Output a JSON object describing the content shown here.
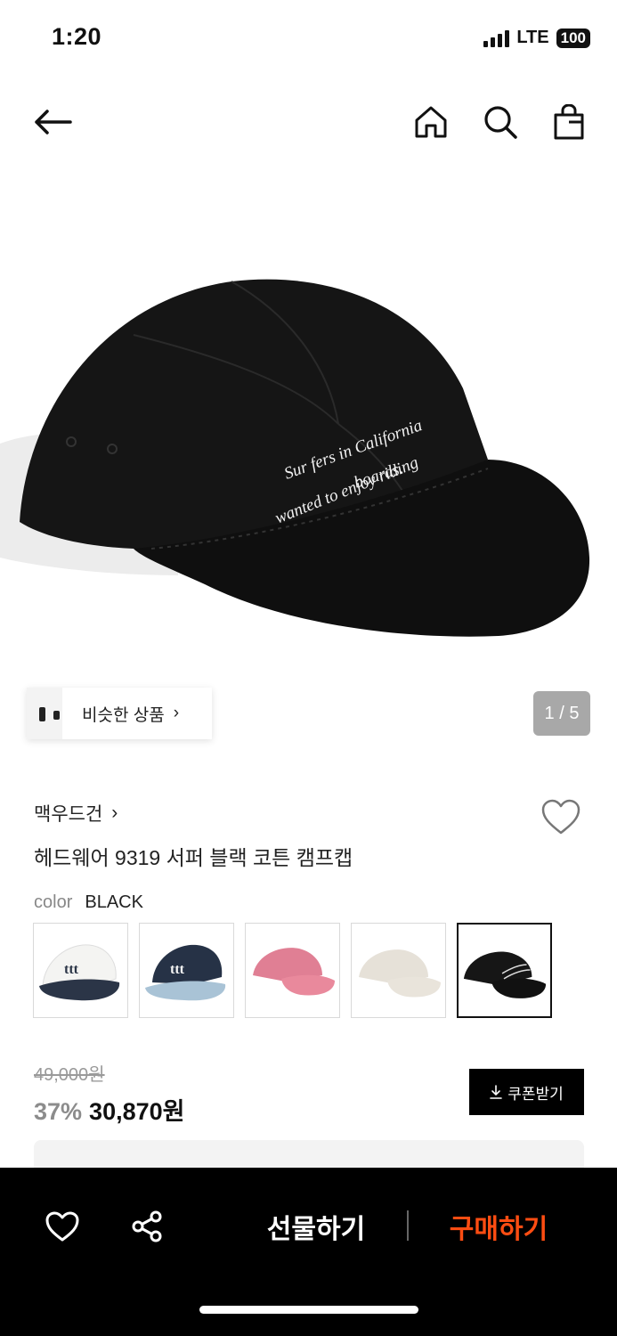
{
  "status_bar": {
    "time": "1:20",
    "network": "LTE",
    "battery": "100"
  },
  "nav": {
    "back_icon": "arrow-left-icon",
    "home_icon": "home-icon",
    "search_icon": "search-icon",
    "bag_icon": "shopping-bag-icon"
  },
  "hero": {
    "embroidery_lines": [
      "Sur fers in California",
      "wanted to enjoy riding",
      "boards."
    ],
    "similar_label": "비슷한 상품",
    "page_counter": "1 / 5"
  },
  "product": {
    "brand": "맥우드건",
    "name": "헤드웨어 9319 서퍼 블랙 코튼 캠프캡",
    "color_label": "color",
    "color_value": "BLACK",
    "swatches": [
      {
        "name": "white-navy",
        "crown": "#f4f4f2",
        "bill": "#2b3547"
      },
      {
        "name": "navy-lightblue",
        "crown": "#263246",
        "bill": "#a9c3d6"
      },
      {
        "name": "pink",
        "crown": "#e07f94",
        "bill": "#e9899c"
      },
      {
        "name": "ivory",
        "crown": "#e6e1d8",
        "bill": "#e9e4db"
      },
      {
        "name": "black",
        "crown": "#161616",
        "bill": "#111111"
      }
    ]
  },
  "price": {
    "original": "49,000원",
    "discount": "37%",
    "final": "30,870원",
    "coupon_label": "쿠폰받기"
  },
  "bottom_bar": {
    "gift_label": "선물하기",
    "buy_label": "구매하기"
  },
  "colors": {
    "accent": "#ff4d12",
    "bottom_bar_bg": "#000000",
    "counter_bg": "#a8a8a8"
  }
}
